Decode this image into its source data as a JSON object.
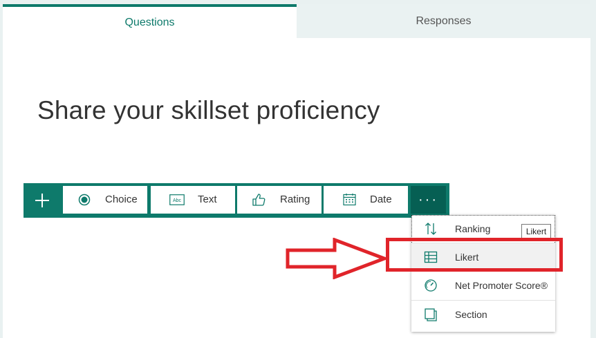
{
  "tabs": [
    {
      "label": "Questions",
      "active": true
    },
    {
      "label": "Responses",
      "active": false
    }
  ],
  "form": {
    "title": "Share your skillset proficiency"
  },
  "toolbar": {
    "add_icon": "plus-icon",
    "buttons": [
      {
        "label": "Choice",
        "icon": "radio-icon"
      },
      {
        "label": "Text",
        "icon": "abc-icon"
      },
      {
        "label": "Rating",
        "icon": "thumbs-up-icon"
      },
      {
        "label": "Date",
        "icon": "calendar-icon"
      }
    ],
    "more_label": "···"
  },
  "menu": {
    "items": [
      {
        "label": "Ranking",
        "icon": "ranking-icon"
      },
      {
        "label": "Likert",
        "icon": "likert-icon"
      },
      {
        "label": "Net Promoter Score®",
        "icon": "gauge-icon"
      },
      {
        "label": "Section",
        "icon": "section-icon"
      }
    ],
    "tooltip": "Likert"
  },
  "colors": {
    "accent": "#0e7a6b",
    "accent_dark": "#065f53",
    "annotation": "#e0242a"
  }
}
